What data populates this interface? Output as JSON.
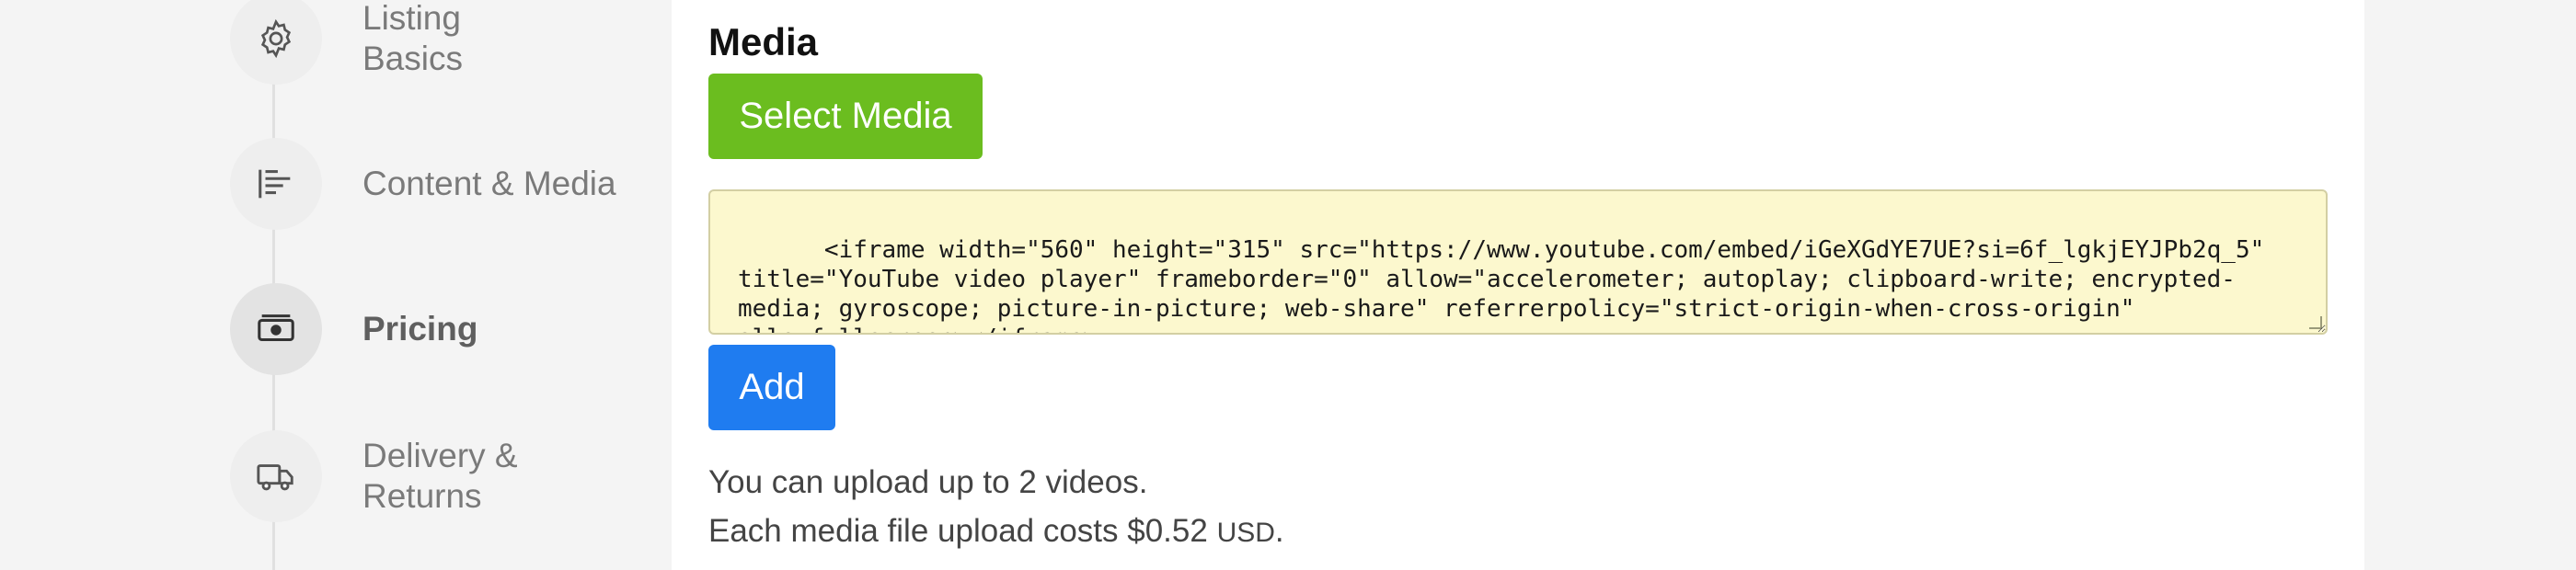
{
  "stepper": {
    "steps": [
      {
        "label": "Listing Basics",
        "icon": "gear-icon",
        "active": false
      },
      {
        "label": "Content & Media",
        "icon": "text-lines-icon",
        "active": false
      },
      {
        "label": "Pricing",
        "icon": "money-icon",
        "active": true
      },
      {
        "label": "Delivery & Returns",
        "icon": "truck-icon",
        "active": false
      }
    ]
  },
  "main": {
    "section_title": "Media",
    "select_media_label": "Select Media",
    "embed_code": "<iframe width=\"560\" height=\"315\" src=\"https://www.youtube.com/embed/iGeXGdYE7UE?si=6f_lgkjEYJPb2q_5\" title=\"YouTube video player\" frameborder=\"0\" allow=\"accelerometer; autoplay; clipboard-write; encrypted-media; gyroscope; picture-in-picture; web-share\" referrerpolicy=\"strict-origin-when-cross-origin\" allowfullscreen></iframe>",
    "add_label": "Add",
    "upload_limit_text": "You can upload up to 2 videos.",
    "cost_text": "Each media file upload costs $0.52",
    "currency": "USD",
    "cost_suffix": "."
  },
  "colors": {
    "select_button": "#6bbd1f",
    "add_button": "#1f7cf0",
    "embed_background": "#fcf8ce"
  }
}
